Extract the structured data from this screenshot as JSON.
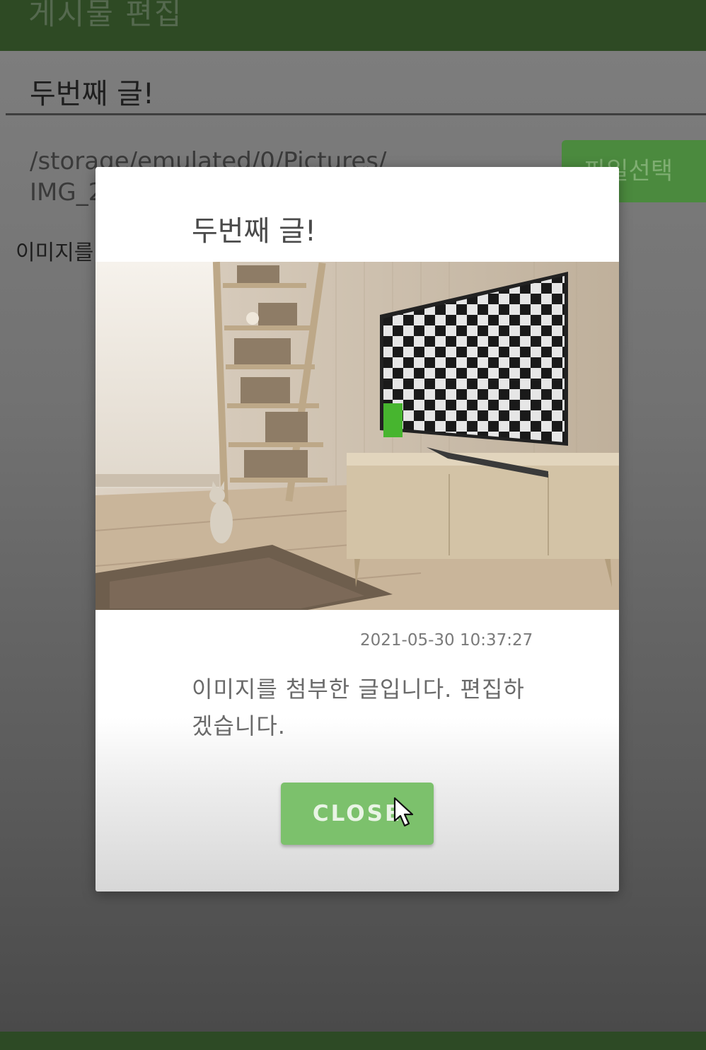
{
  "app_bar": {
    "title": "게시물 편집"
  },
  "editor": {
    "title_value": "두번째 글!",
    "file_path": "/storage/emulated/0/Pictures/\nIMG_2",
    "file_select_label": "파일선택",
    "preview_text": "이미지를"
  },
  "dialog": {
    "title": "두번째 글!",
    "timestamp": "2021-05-30 10:37:27",
    "body": "이미지를 첨부한 글입니다. 편집하겠습니다.",
    "close_label": "CLOSE"
  },
  "colors": {
    "app_bar": "#2e4a24",
    "accent_button": "#7cc16c",
    "scrim": "#6d6d6d"
  }
}
